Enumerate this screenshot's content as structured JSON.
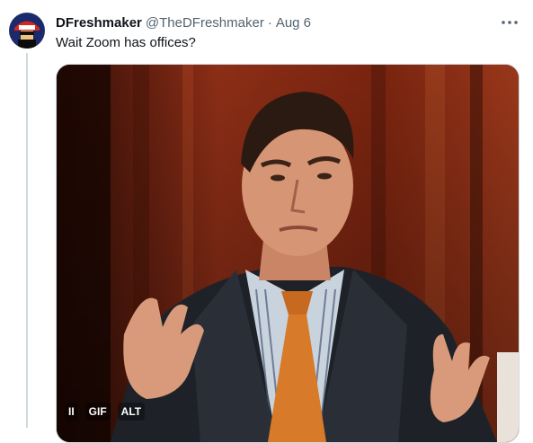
{
  "tweet": {
    "display_name": "DFreshmaker",
    "handle": "@TheDFreshmaker",
    "separator": "·",
    "timestamp": "Aug 6",
    "text": "Wait Zoom has offices?",
    "more_icon": "more-horizontal-icon"
  },
  "media": {
    "type": "gif",
    "alt_description_icon": "person-in-suit-gesturing-image",
    "controls": {
      "pause_label": "II",
      "gif_label": "GIF",
      "alt_label": "ALT"
    }
  },
  "colors": {
    "text_primary": "#0f1419",
    "text_secondary": "#536471",
    "border": "#cfd9de",
    "background": "#ffffff"
  }
}
